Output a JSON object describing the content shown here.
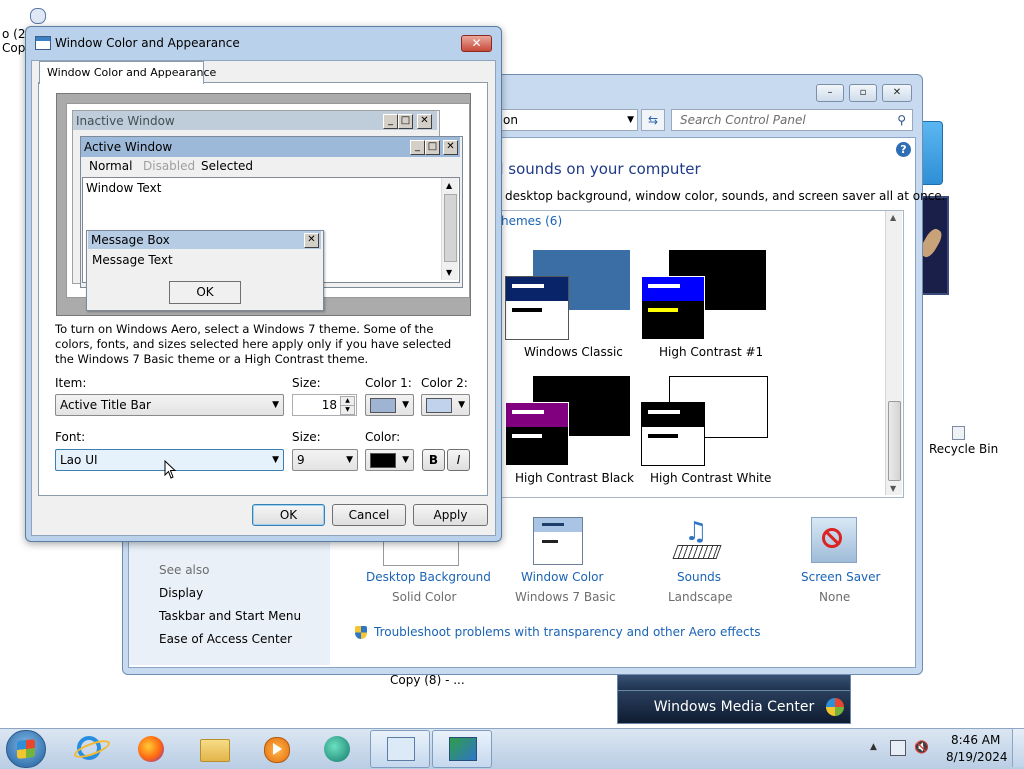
{
  "desktop": {
    "left_label_1": "o (2)",
    "left_label_2": "Cop",
    "recycle_bin": "Recycle Bin",
    "copy_label": "Copy (8) - ..."
  },
  "gadgets": {
    "media_center": "Windows Media Center"
  },
  "control_panel": {
    "address_fragment": "on",
    "search_placeholder": "Search Control Panel",
    "heading": "d sounds on your computer",
    "description": "desktop background, window color, sounds, and screen saver all at once.",
    "themes_header": "hemes (6)",
    "themes": [
      {
        "label": "Windows Classic"
      },
      {
        "label": "High Contrast #1"
      },
      {
        "label": "High Contrast Black"
      },
      {
        "label": "High Contrast White"
      }
    ],
    "see_also_title": "See also",
    "see_also": [
      "Display",
      "Taskbar and Start Menu",
      "Ease of Access Center"
    ],
    "bottom_items": [
      {
        "title": "Desktop Background",
        "value": "Solid Color"
      },
      {
        "title": "Window Color",
        "value": "Windows 7 Basic"
      },
      {
        "title": "Sounds",
        "value": "Landscape"
      },
      {
        "title": "Screen Saver",
        "value": "None"
      }
    ],
    "troubleshoot": "Troubleshoot problems with transparency and other Aero effects"
  },
  "dialog": {
    "title": "Window Color and Appearance",
    "tab": "Window Color and Appearance",
    "preview": {
      "inactive_title": "Inactive Window",
      "active_title": "Active Window",
      "menu_normal": "Normal",
      "menu_disabled": "Disabled",
      "menu_selected": "Selected",
      "window_text": "Window Text",
      "msgbox_title": "Message Box",
      "msgbox_text": "Message Text",
      "msgbox_ok": "OK"
    },
    "instructions": "To turn on Windows Aero, select a Windows 7 theme.  Some of the colors, fonts, and sizes selected here apply only if you have selected the Windows 7 Basic theme or a High Contrast theme.",
    "item_label": "Item:",
    "item_value": "Active Title Bar",
    "size_label": "Size:",
    "size_value": "18",
    "color1_label": "Color 1:",
    "color2_label": "Color 2:",
    "font_label": "Font:",
    "font_value": "Lao UI",
    "font_size_label": "Size:",
    "font_size_value": "9",
    "font_color_label": "Color:",
    "bold": "B",
    "italic": "I",
    "ok": "OK",
    "cancel": "Cancel",
    "apply": "Apply"
  },
  "taskbar": {
    "time": "8:46 AM",
    "date": "8/19/2024"
  },
  "colors": {
    "color1_swatch": "#9fb4d3",
    "color2_swatch": "#c1d3ec",
    "font_color_swatch": "#000000",
    "classic_title": "#3a6ea5",
    "hc1_title": "#0000ff",
    "hcb_title": "#800080"
  }
}
